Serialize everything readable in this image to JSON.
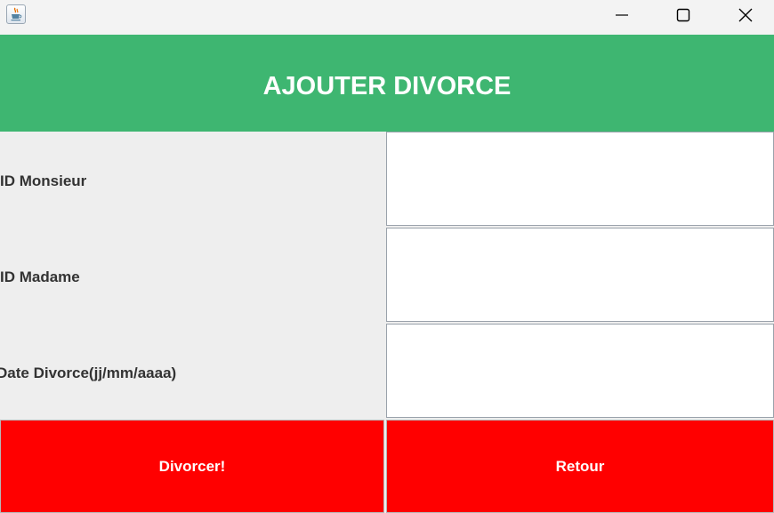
{
  "window": {
    "icon": "java-coffee-cup-icon",
    "controls": [
      "minimize-icon",
      "maximize-icon",
      "close-icon"
    ]
  },
  "header": {
    "title": "AJOUTER DIVORCE",
    "color": "#3eb671"
  },
  "form": {
    "fields": [
      {
        "label": "ID Monsieur",
        "value": ""
      },
      {
        "label": "ID Madame",
        "value": ""
      },
      {
        "label": "Date Divorce(jj/mm/aaaa)",
        "value": ""
      }
    ]
  },
  "buttons": {
    "divorcer_label": "Divorcer!",
    "retour_label": "Retour",
    "color": "#ff0000"
  }
}
